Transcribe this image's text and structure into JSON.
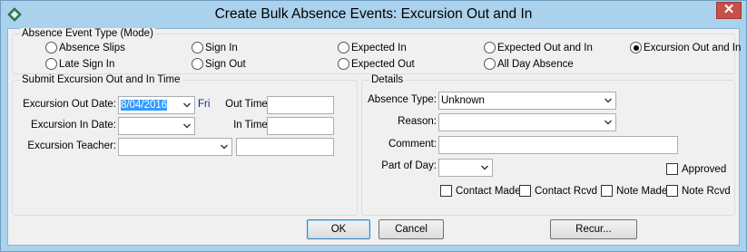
{
  "window": {
    "title": "Create Bulk Absence Events: Excursion Out and In",
    "close_label": "✕"
  },
  "mode": {
    "legend": "Absence Event Type (Mode)",
    "options": [
      {
        "label": "Absence Slips",
        "selected": false
      },
      {
        "label": "Sign In",
        "selected": false
      },
      {
        "label": "Expected In",
        "selected": false
      },
      {
        "label": "Expected Out and In",
        "selected": false
      },
      {
        "label": "Excursion Out and In",
        "selected": true
      },
      {
        "label": "Late Sign In",
        "selected": false
      },
      {
        "label": "Sign Out",
        "selected": false
      },
      {
        "label": "Expected Out",
        "selected": false
      },
      {
        "label": "All Day Absence",
        "selected": false
      }
    ]
  },
  "excursion": {
    "legend": "Submit Excursion Out and In Time",
    "out_date_label": "Excursion Out Date:",
    "out_date_value": "8/04/2016",
    "out_day": "Fri",
    "out_time_label": "Out Time:",
    "out_time_value": "",
    "in_date_label": "Excursion In Date:",
    "in_date_value": "",
    "in_time_label": "In Time:",
    "in_time_value": "",
    "teacher_label": "Excursion Teacher:",
    "teacher_value": "",
    "teacher_extra_value": ""
  },
  "details": {
    "legend": "Details",
    "absence_type_label": "Absence Type:",
    "absence_type_value": "Unknown",
    "reason_label": "Reason:",
    "reason_value": "",
    "comment_label": "Comment:",
    "comment_value": "",
    "part_of_day_label": "Part of Day:",
    "part_of_day_value": "",
    "approved_label": "Approved",
    "contact_made_label": "Contact Made",
    "contact_rcvd_label": "Contact Rcvd",
    "note_made_label": "Note Made",
    "note_rcvd_label": "Note Rcvd"
  },
  "buttons": {
    "ok": "OK",
    "cancel": "Cancel",
    "recur": "Recur..."
  },
  "colors": {
    "title_bar": "#abd2ec",
    "close_button": "#c7504a",
    "selection": "#3399ff",
    "dialog_background": "#f0f0f0"
  }
}
